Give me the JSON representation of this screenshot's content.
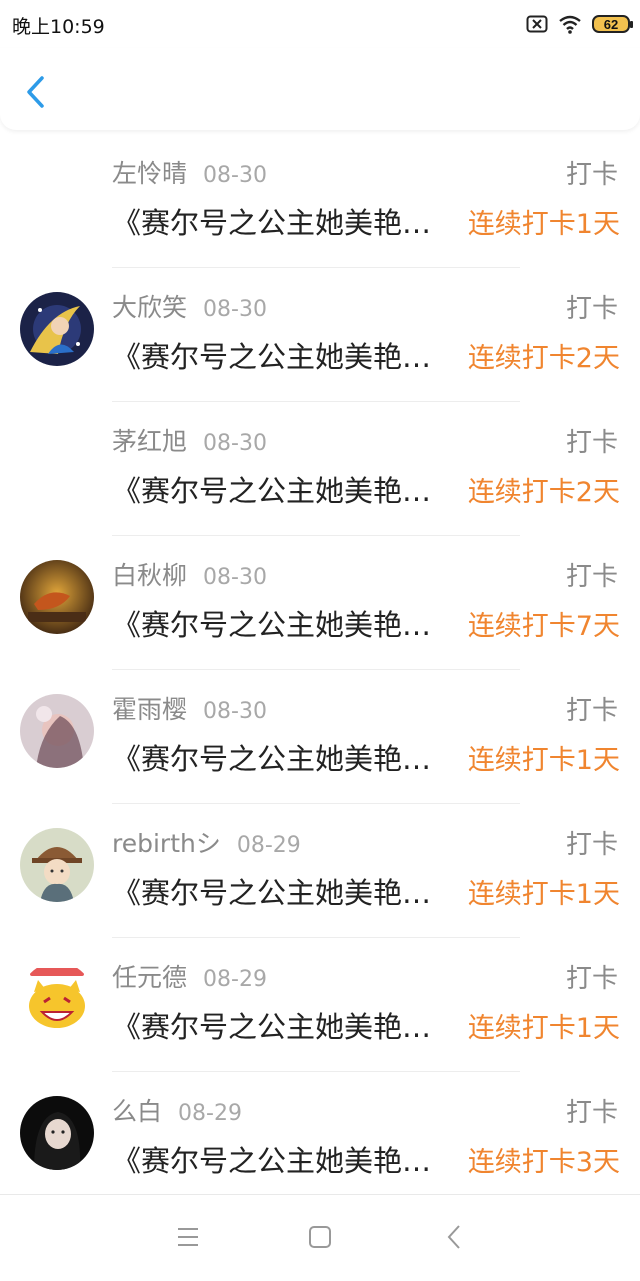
{
  "status_bar": {
    "time": "晚上10:59",
    "battery": "62"
  },
  "header": {
    "back_icon": "chevron-left-icon"
  },
  "items": [
    {
      "name": "左怜晴",
      "date": "08-30",
      "action": "打卡",
      "book": "《赛尔号之公主她美艳…",
      "streak": "连续打卡1天",
      "avatar": "none"
    },
    {
      "name": "大欣笑",
      "date": "08-30",
      "action": "打卡",
      "book": "《赛尔号之公主她美艳…",
      "streak": "连续打卡2天",
      "avatar": "anime"
    },
    {
      "name": "茅红旭",
      "date": "08-30",
      "action": "打卡",
      "book": "《赛尔号之公主她美艳…",
      "streak": "连续打卡2天",
      "avatar": "none"
    },
    {
      "name": "白秋柳",
      "date": "08-30",
      "action": "打卡",
      "book": "《赛尔号之公主她美艳…",
      "streak": "连续打卡7天",
      "avatar": "leaf"
    },
    {
      "name": "霍雨樱",
      "date": "08-30",
      "action": "打卡",
      "book": "《赛尔号之公主她美艳…",
      "streak": "连续打卡1天",
      "avatar": "girl"
    },
    {
      "name": "rebirthシ",
      "date": "08-29",
      "action": "打卡",
      "book": "《赛尔号之公主她美艳…",
      "streak": "连续打卡1天",
      "avatar": "cartoon"
    },
    {
      "name": "任元德",
      "date": "08-29",
      "action": "打卡",
      "book": "《赛尔号之公主她美艳…",
      "streak": "连续打卡1天",
      "avatar": "emoji"
    },
    {
      "name": "么白",
      "date": "08-29",
      "action": "打卡",
      "book": "《赛尔号之公主她美艳…",
      "streak": "连续打卡3天",
      "avatar": "dark"
    }
  ],
  "nav": {
    "menu_icon": "menu-icon",
    "home_icon": "home-square-icon",
    "back_icon": "back-triangle-icon"
  },
  "colors": {
    "accent_blue": "#2d9be8",
    "streak_orange": "#f0852f"
  }
}
